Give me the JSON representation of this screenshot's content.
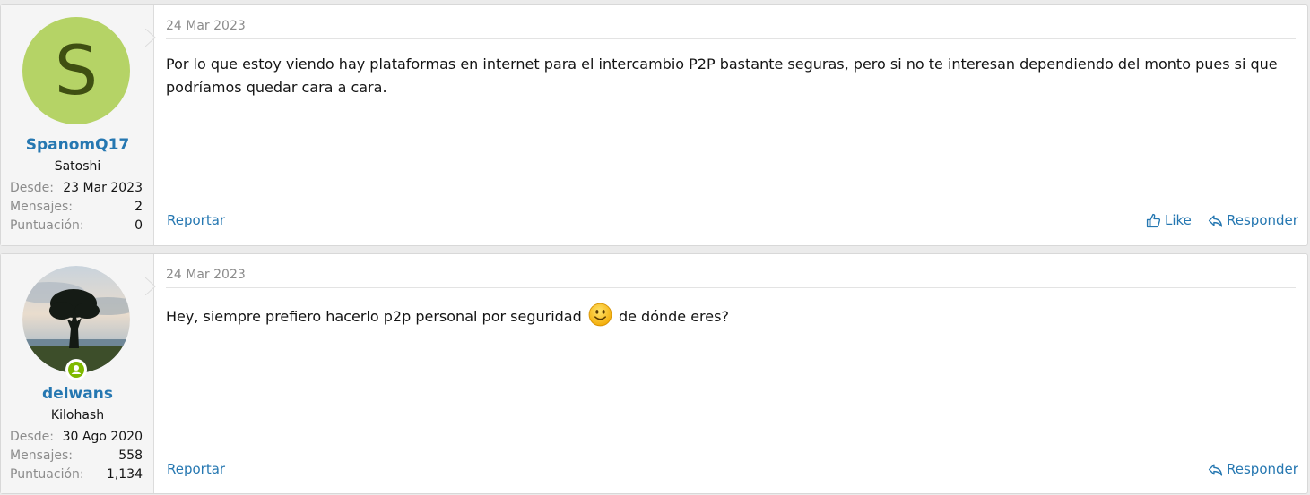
{
  "posts": [
    {
      "user": {
        "avatar_letter": "S",
        "username": "SpanomQ17",
        "title": "Satoshi",
        "stats": [
          {
            "label": "Desde:",
            "value": "23 Mar 2023"
          },
          {
            "label": "Mensajes:",
            "value": "2"
          },
          {
            "label": "Puntuación:",
            "value": "0"
          }
        ]
      },
      "date": "24 Mar 2023",
      "text": "Por lo que estoy viendo hay plataformas en internet para el intercambio P2P bastante seguras, pero si no te interesan dependiendo del monto pues si que podríamos quedar cara a cara.",
      "report_label": "Reportar",
      "like_label": "Like",
      "reply_label": "Responder"
    },
    {
      "user": {
        "username": "delwans",
        "title": "Kilohash",
        "online": true,
        "stats": [
          {
            "label": "Desde:",
            "value": "30 Ago 2020"
          },
          {
            "label": "Mensajes:",
            "value": "558"
          },
          {
            "label": "Puntuación:",
            "value": "1,134"
          }
        ]
      },
      "date": "24 Mar 2023",
      "text_before": "Hey, siempre prefiero hacerlo p2p personal por seguridad",
      "text_after": "de dónde eres?",
      "report_label": "Reportar",
      "reply_label": "Responder"
    }
  ],
  "colors": {
    "link": "#2577b1",
    "avatar_bg": "#b5d366",
    "online": "#7fb900"
  }
}
